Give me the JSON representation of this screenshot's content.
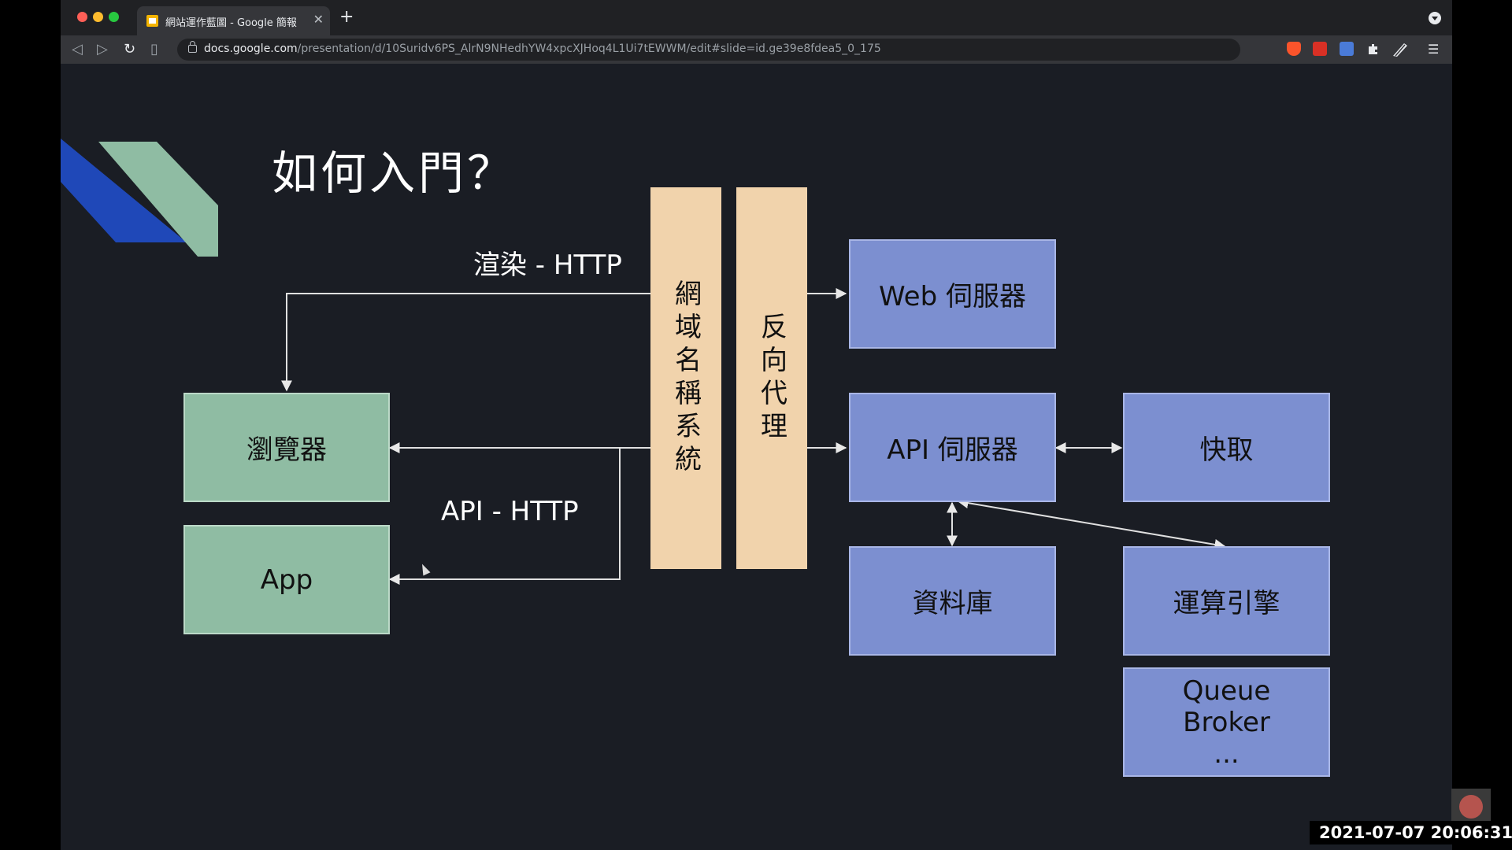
{
  "browser": {
    "tab_title": "網站運作藍圖 - Google 簡報",
    "url_host": "docs.google.com",
    "url_path": "/presentation/d/10Suridv6PS_AlrN9NHedhYW4xpcXJHoq4L1Ui7tEWWM/edit#slide=id.ge39e8fdea5_0_175",
    "traffic_lights": [
      "#ff5f57",
      "#febc2e",
      "#28c840"
    ]
  },
  "slide": {
    "title": "如何入門？",
    "render_label": "渲染 - HTTP",
    "api_label": "API - HTTP",
    "clients": {
      "browser": "瀏覽器",
      "app": "App"
    },
    "middle": {
      "dns": "網域名稱系統",
      "reverse_proxy": "反向代理"
    },
    "servers": {
      "web": "Web 伺服器",
      "api": "API 伺服器",
      "cache": "快取",
      "database": "資料庫",
      "compute": "運算引擎",
      "queue": "Queue\nBroker\n..."
    },
    "colors": {
      "background": "#1a1d24",
      "client_green": "#8fbca3",
      "server_blue": "#7c8fd0",
      "middle_tan": "#f1d3ac",
      "logo_blue": "#1f48b8",
      "logo_green": "#8fbca3"
    }
  },
  "overlay": {
    "timestamp": "2021-07-07  20:06:31"
  }
}
